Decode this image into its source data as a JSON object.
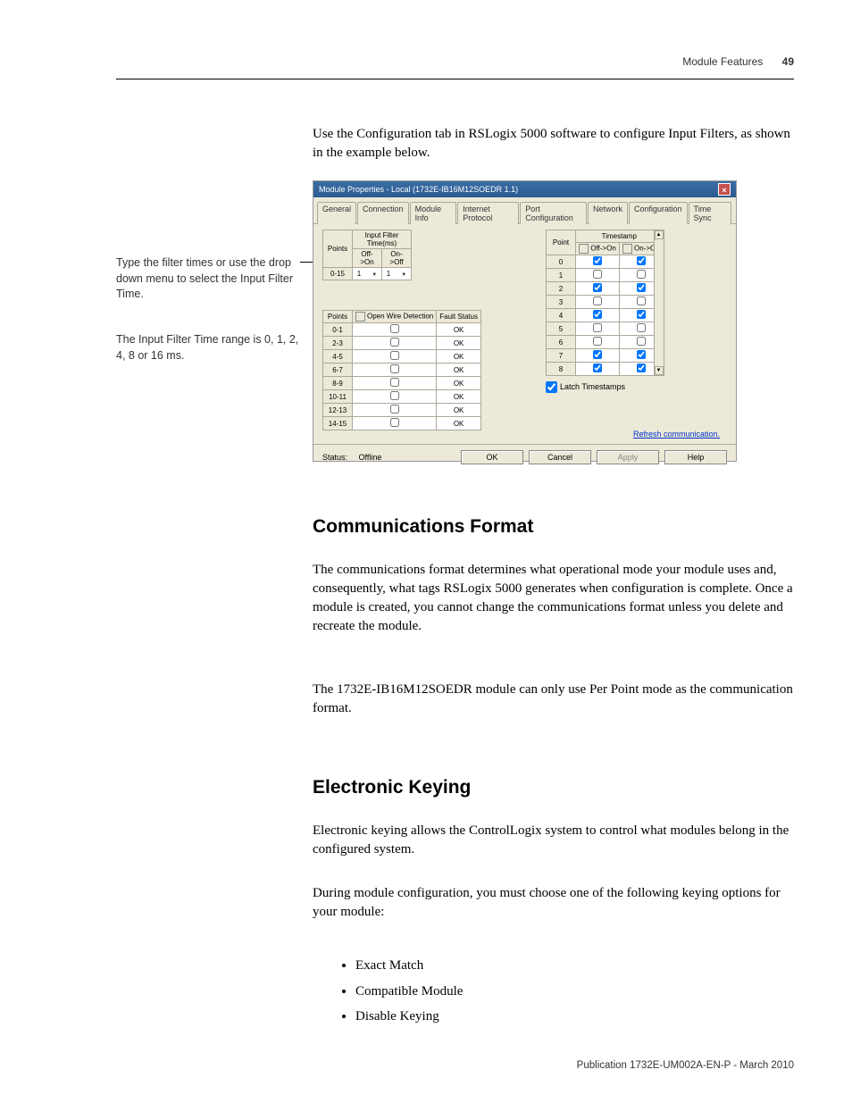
{
  "header": {
    "section": "Module Features",
    "page_num": "49"
  },
  "intro_para": "Use the Configuration tab in RSLogix 5000 software to configure Input Filters, as shown in the example below.",
  "sidebar": {
    "label1": "Type the filter times or use the drop down menu to select the Input Filter Time.",
    "label2": "The Input Filter Time range is 0, 1, 2, 4, 8 or 16 ms."
  },
  "dialog": {
    "title": "Module Properties - Local (1732E-IB16M12SOEDR 1.1)",
    "tabs": [
      "General",
      "Connection",
      "Module Info",
      "Internet Protocol",
      "Port Configuration",
      "Network",
      "Configuration",
      "Time Sync"
    ],
    "active_tab": "Configuration",
    "filter_table": {
      "header_points": "Points",
      "header_main": "Input Filter Time(ms)",
      "header_off_on": "Off->On",
      "header_on_off": "On->Off",
      "row_label": "0-15",
      "val1": "1",
      "val2": "1"
    },
    "fault_table": {
      "header_points": "Points",
      "header_detection": "Open Wire Detection",
      "header_fault": "Fault Status",
      "rows": [
        {
          "label": "0-1",
          "status": "OK"
        },
        {
          "label": "2-3",
          "status": "OK"
        },
        {
          "label": "4-5",
          "status": "OK"
        },
        {
          "label": "6-7",
          "status": "OK"
        },
        {
          "label": "8-9",
          "status": "OK"
        },
        {
          "label": "10-11",
          "status": "OK"
        },
        {
          "label": "12-13",
          "status": "OK"
        },
        {
          "label": "14-15",
          "status": "OK"
        }
      ]
    },
    "timestamp_table": {
      "header_point": "Point",
      "header_main": "Timestamp",
      "header_off_on": "Off->On",
      "header_on_off": "On->Off",
      "checkall_label": "✓",
      "rows": [
        {
          "pt": "0",
          "a": true,
          "b": true
        },
        {
          "pt": "1",
          "a": false,
          "b": false
        },
        {
          "pt": "2",
          "a": true,
          "b": true
        },
        {
          "pt": "3",
          "a": false,
          "b": false
        },
        {
          "pt": "4",
          "a": true,
          "b": true
        },
        {
          "pt": "5",
          "a": false,
          "b": false
        },
        {
          "pt": "6",
          "a": false,
          "b": false
        },
        {
          "pt": "7",
          "a": true,
          "b": true
        },
        {
          "pt": "8",
          "a": true,
          "b": true
        }
      ]
    },
    "latch_label": "Latch Timestamps",
    "refresh_link": "Refresh communication.",
    "status_label": "Status:",
    "status_value": "Offline",
    "buttons": {
      "ok": "OK",
      "cancel": "Cancel",
      "apply": "Apply",
      "help": "Help"
    }
  },
  "comms": {
    "heading": "Communications Format",
    "p1": "The communications format determines what operational mode your module uses and, consequently, what tags RSLogix 5000 generates when configuration is complete. Once a module is created, you cannot change the communications format unless you delete and recreate the module.",
    "p2": "The 1732E-IB16M12SOEDR module can only use Per Point mode as the communication format."
  },
  "keying": {
    "heading": "Electronic Keying",
    "p1": "Electronic keying allows the ControlLogix system to control what modules belong in the configured system.",
    "p2": "During module configuration, you must choose one of the following keying options for your module:",
    "bullets": [
      "Exact Match",
      "Compatible Module",
      "Disable Keying"
    ]
  },
  "footer": "Publication 1732E-UM002A-EN-P - March 2010"
}
